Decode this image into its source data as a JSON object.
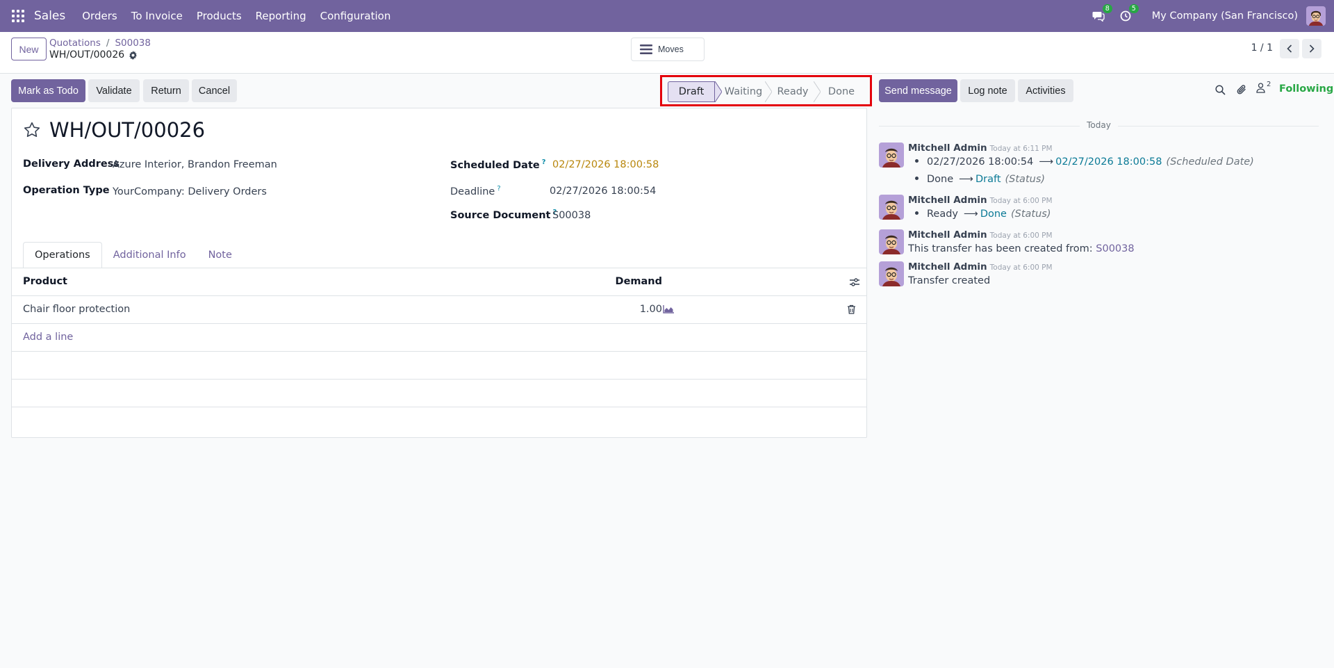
{
  "navbar": {
    "app_name": "Sales",
    "menu": [
      "Orders",
      "To Invoice",
      "Products",
      "Reporting",
      "Configuration"
    ],
    "messages_count": "8",
    "activities_count": "5",
    "company": "My Company (San Francisco)"
  },
  "control_panel": {
    "new_label": "New",
    "breadcrumb": [
      "Quotations",
      "S00038"
    ],
    "record_name": "WH/OUT/00026",
    "moves_label": "Moves",
    "pager": "1 / 1"
  },
  "actions": {
    "mark_as_todo": "Mark as Todo",
    "validate": "Validate",
    "return": "Return",
    "cancel": "Cancel"
  },
  "statusbar": {
    "stages": [
      "Draft",
      "Waiting",
      "Ready",
      "Done"
    ],
    "active": "Draft"
  },
  "form": {
    "title": "WH/OUT/00026",
    "delivery_address_label": "Delivery Address",
    "delivery_address": "Azure Interior, Brandon Freeman",
    "operation_type_label": "Operation Type",
    "operation_type": "YourCompany: Delivery Orders",
    "scheduled_date_label": "Scheduled Date",
    "scheduled_date": "02/27/2026 18:00:58",
    "deadline_label": "Deadline",
    "deadline": "02/27/2026 18:00:54",
    "source_document_label": "Source Document",
    "source_document": "S00038",
    "help_mark": "?"
  },
  "tabs": [
    "Operations",
    "Additional Info",
    "Note"
  ],
  "operations_table": {
    "headers": {
      "product": "Product",
      "demand": "Demand"
    },
    "rows": [
      {
        "product": "Chair floor protection",
        "demand": "1.00"
      }
    ],
    "add_line": "Add a line"
  },
  "chatter": {
    "send_message": "Send message",
    "log_note": "Log note",
    "activities": "Activities",
    "followers_count": "2",
    "following": "Following",
    "day_separator": "Today",
    "messages": [
      {
        "author": "Mitchell Admin",
        "time": "Today at 6:11 PM",
        "changes": [
          {
            "old": "02/27/2026 18:00:54",
            "new": "02/27/2026 18:00:58",
            "field": "(Scheduled Date)"
          },
          {
            "old": "Done",
            "new": "Draft",
            "field": "(Status)"
          }
        ]
      },
      {
        "author": "Mitchell Admin",
        "time": "Today at 6:00 PM",
        "changes": [
          {
            "old": "Ready",
            "new": "Done",
            "field": "(Status)"
          }
        ]
      },
      {
        "author": "Mitchell Admin",
        "time": "Today at 6:00 PM",
        "body": "This transfer has been created from:",
        "body_link": "S00038"
      },
      {
        "author": "Mitchell Admin",
        "time": "Today at 6:00 PM",
        "body": "Transfer created"
      }
    ]
  },
  "colors": {
    "brand": "#71639e",
    "highlight_box": "#e4000b",
    "date_warning": "#b8860b",
    "tracking_value": "#0b7a96",
    "badge": "#28a745"
  }
}
